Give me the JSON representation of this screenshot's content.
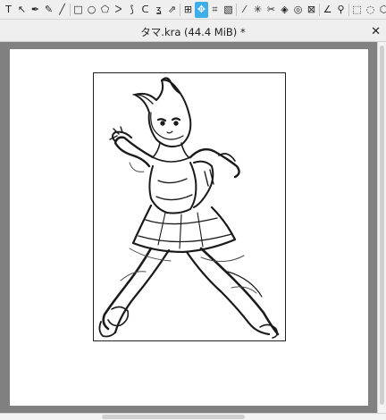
{
  "toolbar": {
    "tools": [
      {
        "name": "text-tool-icon",
        "glyph": "T"
      },
      {
        "name": "edit-shapes-tool-icon",
        "glyph": "↖"
      },
      {
        "name": "calligraphy-tool-icon",
        "glyph": "✒"
      },
      {
        "name": "freehand-brush-tool-icon",
        "glyph": "✎"
      },
      {
        "name": "line-tool-icon",
        "glyph": "╱"
      },
      {
        "name": "rectangle-tool-icon",
        "glyph": "□"
      },
      {
        "name": "ellipse-tool-icon",
        "glyph": "○"
      },
      {
        "name": "polygon-tool-icon",
        "glyph": "⬠"
      },
      {
        "name": "polyline-tool-icon",
        "glyph": "ᐳ"
      },
      {
        "name": "bezier-curve-tool-icon",
        "glyph": "⟆"
      },
      {
        "name": "freehand-path-tool-icon",
        "glyph": "ᑕ"
      },
      {
        "name": "dynamic-brush-tool-icon",
        "glyph": "ʓ"
      },
      {
        "name": "multibrush-tool-icon",
        "glyph": "⇗"
      },
      {
        "name": "transform-tool-icon",
        "glyph": "⊞"
      },
      {
        "name": "move-tool-icon",
        "glyph": "✥",
        "active": true
      },
      {
        "name": "crop-tool-icon",
        "glyph": "⌗"
      },
      {
        "name": "gradient-tool-icon",
        "glyph": "▧"
      },
      {
        "name": "color-sampler-tool-icon",
        "glyph": "⁄"
      },
      {
        "name": "colorize-mask-tool-icon",
        "glyph": "✳"
      },
      {
        "name": "smart-patch-tool-icon",
        "glyph": "✂"
      },
      {
        "name": "fill-tool-icon",
        "glyph": "◈"
      },
      {
        "name": "enclose-fill-tool-icon",
        "glyph": "◎"
      },
      {
        "name": "assistant-tool-icon",
        "glyph": "⊠"
      },
      {
        "name": "measure-tool-icon",
        "glyph": "∠"
      },
      {
        "name": "reference-images-tool-icon",
        "glyph": "⚲"
      },
      {
        "name": "rectangular-selection-tool-icon",
        "glyph": "⬚"
      },
      {
        "name": "elliptical-selection-tool-icon",
        "glyph": "◌"
      },
      {
        "name": "polygonal-selection-tool-icon",
        "glyph": "⬡"
      },
      {
        "name": "freehand-selection-tool-icon",
        "glyph": "◯"
      }
    ]
  },
  "document_tab": {
    "title": "タマ.kra (44.4 MiB) *",
    "close_glyph": "✕"
  },
  "colors": {
    "active_tool": "#3daee9",
    "canvas_background": "#808080",
    "page": "#ffffff"
  }
}
